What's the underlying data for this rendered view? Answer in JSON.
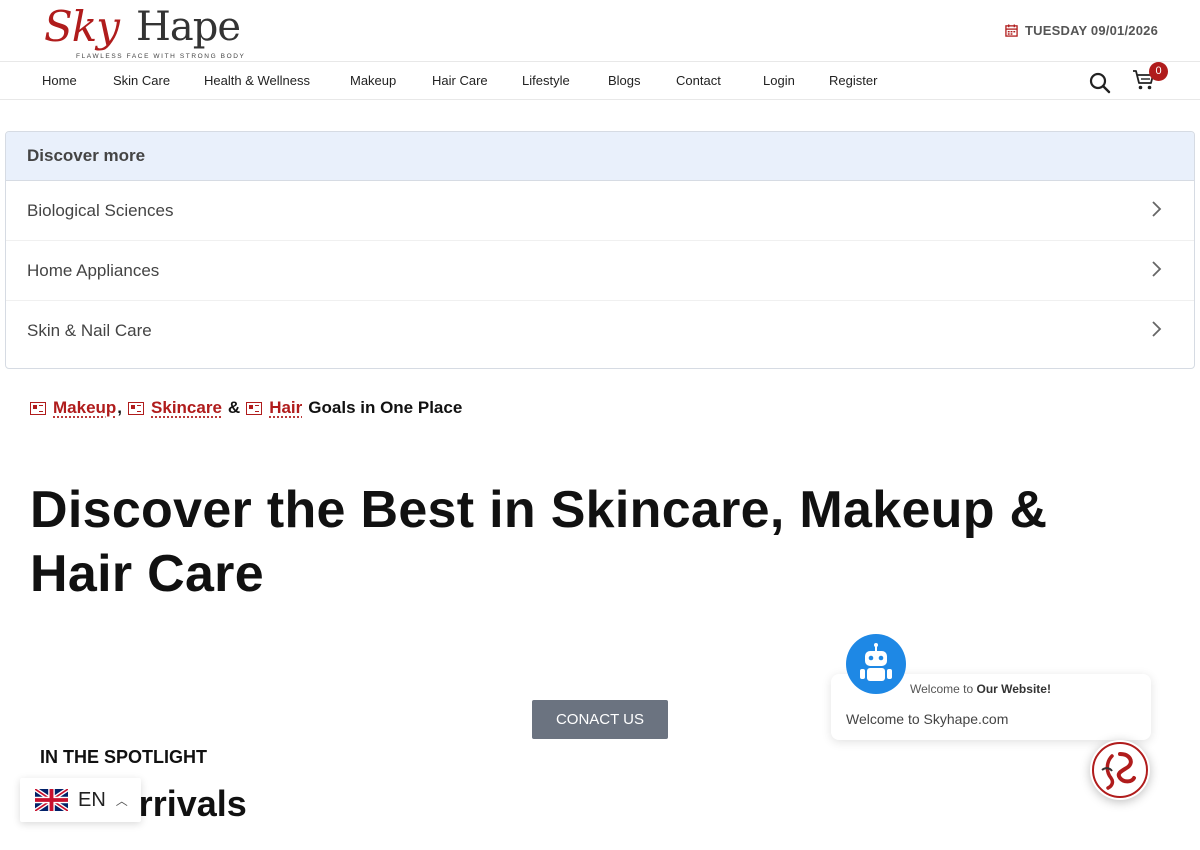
{
  "logo": {
    "sky": "Sky",
    "hape": "Hape",
    "tagline": "FLAWLESS FACE WITH STRONG BODY"
  },
  "header": {
    "date": "TUESDAY 09/01/2026"
  },
  "nav": {
    "items": [
      "Home",
      "Skin Care",
      "Health & Wellness",
      "Makeup",
      "Hair Care",
      "Lifestyle",
      "Blogs",
      "Contact",
      "Login",
      "Register"
    ],
    "cart_count": "0"
  },
  "discover": {
    "title": "Discover more",
    "items": [
      "Biological Sciences",
      "Home Appliances",
      "Skin & Nail Care"
    ]
  },
  "categories": {
    "links": [
      "Makeup",
      "Skincare",
      "Hair"
    ],
    "sep1": ",",
    "sep2": "&",
    "suffix": "Goals in One Place"
  },
  "hero": {
    "title": "Discover the Best in Skincare, Makeup & Hair Care"
  },
  "cta": {
    "label": "CONACT US"
  },
  "spotlight": {
    "kicker": "IN THE SPOTLIGHT",
    "title": "New Arrivals"
  },
  "language": {
    "code": "EN"
  },
  "chat": {
    "header_prefix": "Welcome to",
    "header_bold": "Our Website!",
    "message": "Welcome to Skyhape.com"
  },
  "colors": {
    "brand": "#b01c1c",
    "accent_blue": "#1e88e5",
    "button_gray": "#6b7380",
    "discover_header_bg": "#e9f0fb"
  }
}
